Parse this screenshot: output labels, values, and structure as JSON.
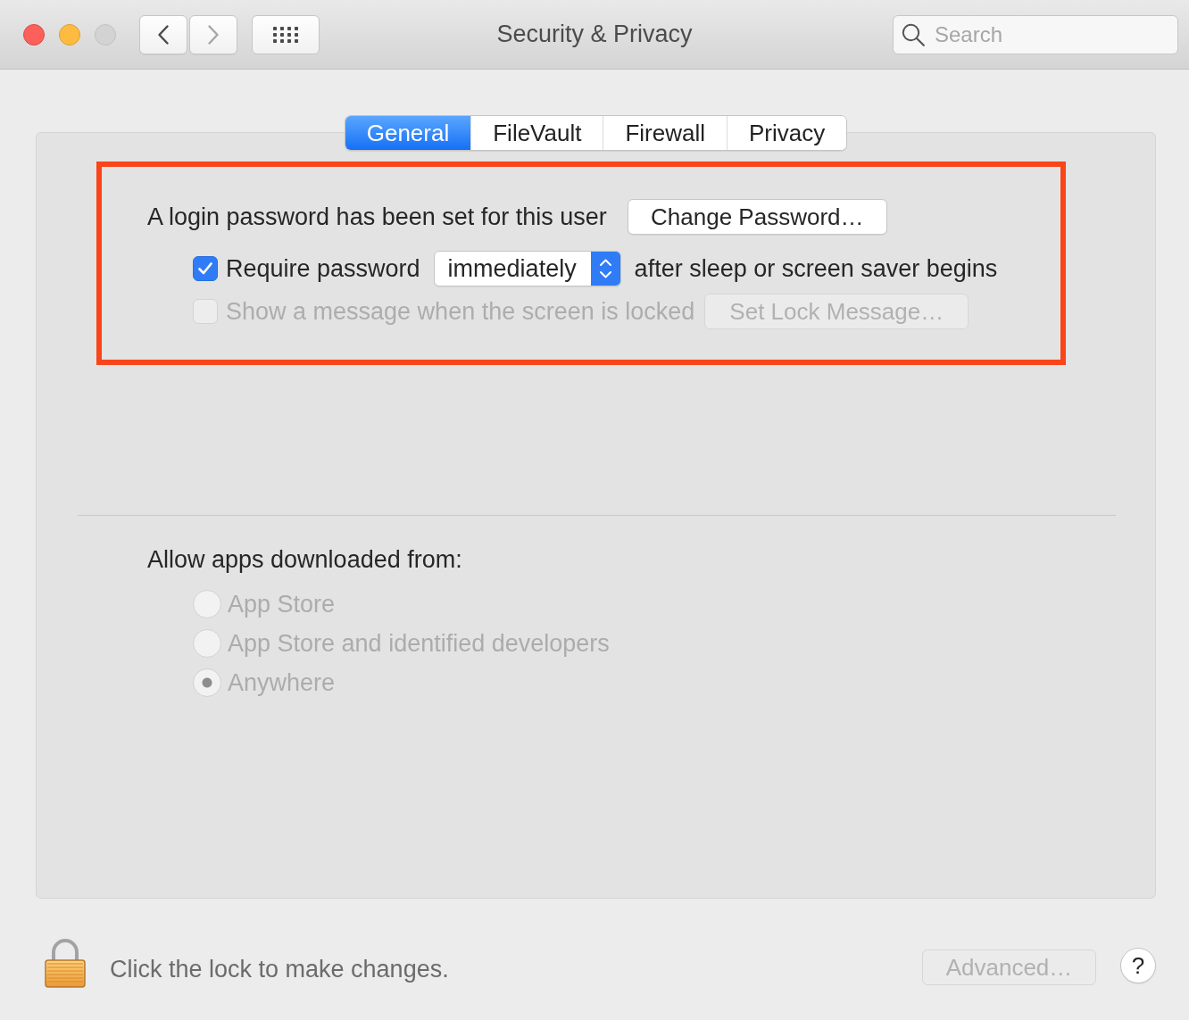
{
  "window": {
    "title": "Security & Privacy",
    "buttons": [
      {
        "kind": "close",
        "disabled": false
      },
      {
        "kind": "minimize",
        "disabled": false
      },
      {
        "kind": "zoom",
        "disabled": true
      }
    ]
  },
  "nav_buttons": [
    {
      "kind": "back",
      "disabled": false
    },
    {
      "kind": "forward",
      "disabled": true
    }
  ],
  "search": {
    "placeholder": "Search"
  },
  "tabs": [
    {
      "label": "General",
      "selected": true
    },
    {
      "label": "FileVault",
      "selected": false
    },
    {
      "label": "Firewall",
      "selected": false
    },
    {
      "label": "Privacy",
      "selected": false
    }
  ],
  "password_section": {
    "highlighted": true,
    "status_text": "A login password has been set for this user",
    "change_button": {
      "label": "Change Password…",
      "disabled": false
    },
    "require": {
      "checked": true,
      "disabled": false,
      "label": "Require password",
      "popup_value": "immediately",
      "suffix": "after sleep or screen saver begins"
    },
    "lock_message": {
      "checked": false,
      "disabled": true,
      "label": "Show a message when the screen is locked",
      "button": {
        "label": "Set Lock Message…",
        "disabled": true
      }
    }
  },
  "downloads": {
    "heading": "Allow apps downloaded from:",
    "options": [
      {
        "label": "App Store",
        "selected": false,
        "disabled": true
      },
      {
        "label": "App Store and identified developers",
        "selected": false,
        "disabled": true
      },
      {
        "label": "Anywhere",
        "selected": true,
        "disabled": true
      }
    ]
  },
  "footer": {
    "lock_text": "Click the lock to make changes.",
    "advanced_button": {
      "label": "Advanced…",
      "disabled": true
    },
    "help_button": "?"
  }
}
